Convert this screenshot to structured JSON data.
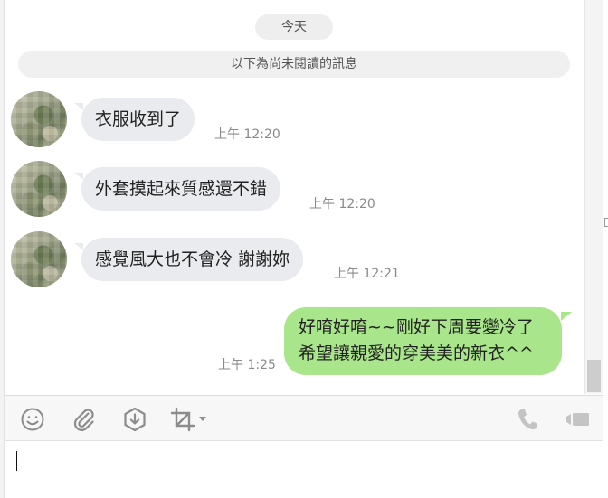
{
  "chat": {
    "date_divider": "今天",
    "unread_notice": "以下為尚未閱讀的訊息",
    "messages": [
      {
        "direction": "incoming",
        "text": "衣服收到了",
        "time": "上午 12:20"
      },
      {
        "direction": "incoming",
        "text": "外套摸起來質感還不錯",
        "time": "上午 12:20"
      },
      {
        "direction": "incoming",
        "text": "感覺風大也不會冷 謝謝妳",
        "time": "上午 12:21"
      },
      {
        "direction": "outgoing",
        "lines": [
          "好唷好唷~~剛好下周要變冷了",
          "希望讓親愛的穿美美的新衣^^"
        ],
        "time": "上午 1:25"
      }
    ]
  },
  "toolbar": {
    "icons": [
      "emoji-icon",
      "attachment-icon",
      "download-icon",
      "crop-icon",
      "dropdown-arrow-icon",
      "phone-icon",
      "video-call-icon"
    ]
  },
  "input": {
    "value": ""
  },
  "colors": {
    "incoming_bubble": "#e9ebee",
    "outgoing_bubble": "#a9e58a",
    "timestamp": "#8a8a8a",
    "icon": "#8c8c8c"
  }
}
